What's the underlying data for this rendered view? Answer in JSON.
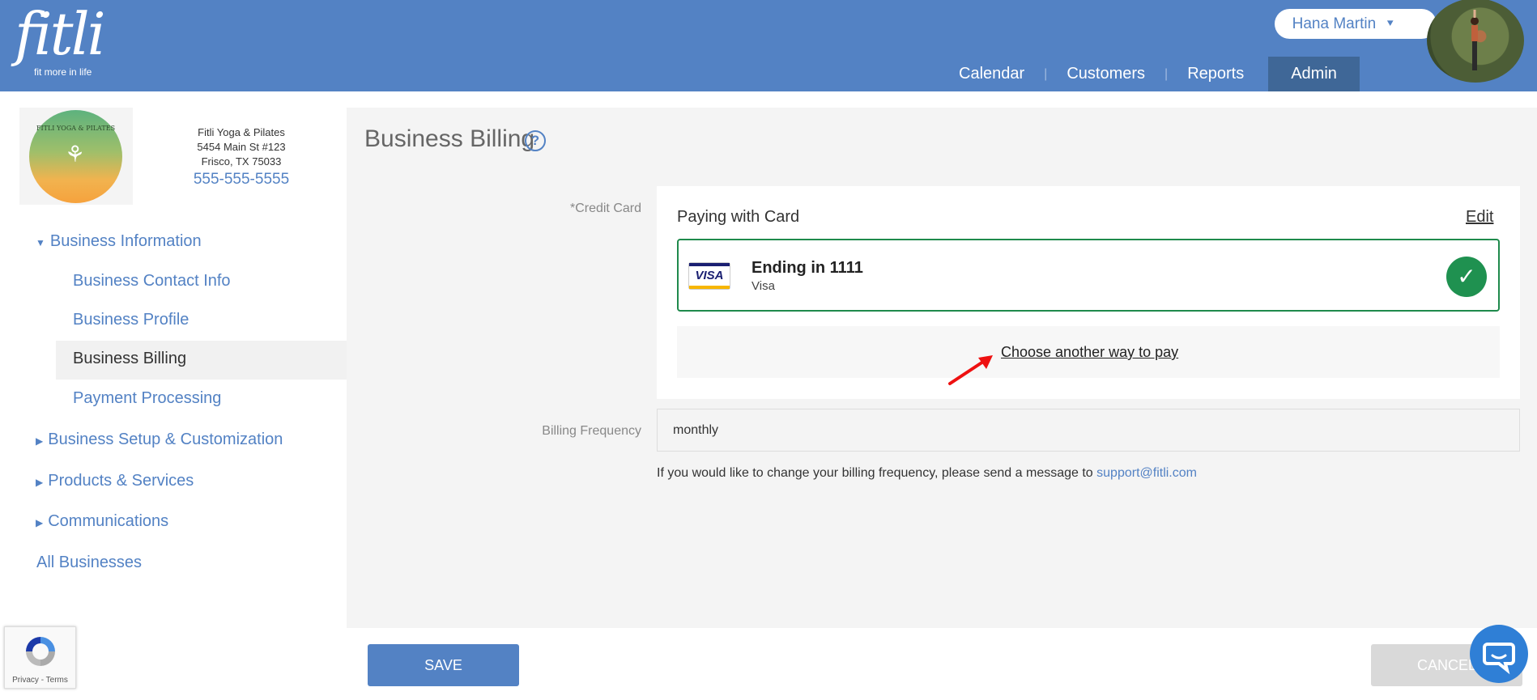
{
  "header": {
    "logo_word": "fitli",
    "logo_tagline": "fit more in life",
    "user_name": "Hana Martin",
    "nav": [
      {
        "label": "Calendar"
      },
      {
        "label": "Customers"
      },
      {
        "label": "Reports"
      },
      {
        "label": "Admin",
        "active": true
      }
    ]
  },
  "business": {
    "logo_text": "FITLI YOGA & PILATES",
    "name": "Fitli Yoga & Pilates",
    "address1": "5454 Main St #123",
    "address2": "Frisco, TX 75033",
    "phone": "555-555-5555"
  },
  "sidebar": {
    "sections": [
      {
        "label": "Business Information",
        "expanded": true
      },
      {
        "label": "Business Setup & Customization"
      },
      {
        "label": "Products & Services"
      },
      {
        "label": "Communications"
      }
    ],
    "sub_items": [
      {
        "label": "Business Contact Info"
      },
      {
        "label": "Business Profile"
      },
      {
        "label": "Business Billing",
        "active": true
      },
      {
        "label": "Payment Processing"
      }
    ],
    "all_businesses": "All Businesses"
  },
  "main": {
    "title": "Business Billing",
    "help_glyph": "?",
    "credit_card_label": "*Credit Card",
    "paying_title": "Paying with Card",
    "edit_label": "Edit",
    "card": {
      "brand_badge": "VISA",
      "ending": "Ending in 1111",
      "brand": "Visa"
    },
    "alt_pay_link": "Choose another way to pay",
    "billing_frequency_label": "Billing Frequency",
    "billing_frequency_value": "monthly",
    "note_text": "If you would like to change your billing frequency, please send a message to ",
    "support_email": "support@fitli.com"
  },
  "footer": {
    "save_label": "SAVE",
    "cancel_label": "CANCEL",
    "recaptcha_text": "Privacy - Terms"
  },
  "colors": {
    "brand_blue": "#5382c4",
    "nav_active": "#3f6797",
    "success_green": "#1f9150"
  }
}
